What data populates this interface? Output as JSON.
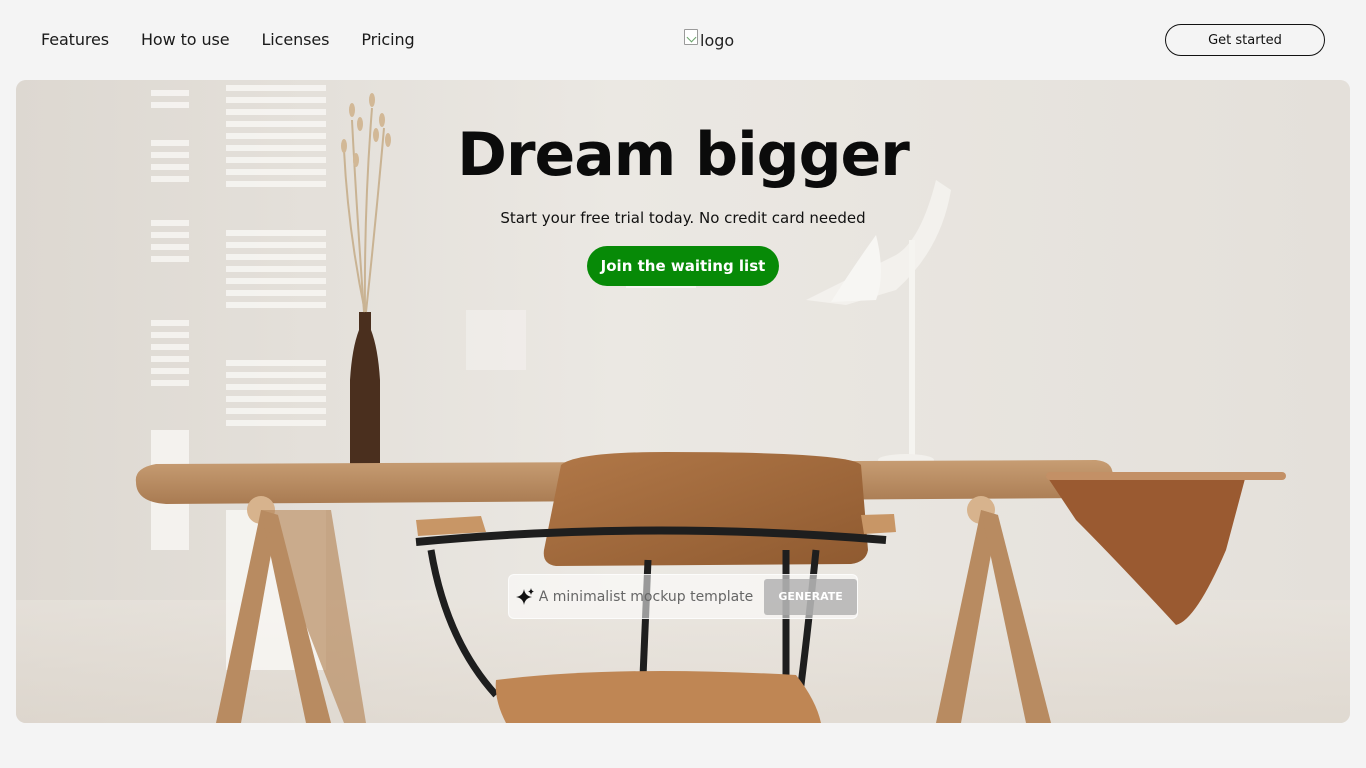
{
  "nav": {
    "links": [
      "Features",
      "How to use",
      "Licenses",
      "Pricing"
    ],
    "logo_alt": "logo",
    "cta_label": "Get started"
  },
  "hero": {
    "title": "Dream bigger",
    "subtitle": "Start your free trial today. No credit card needed",
    "join_label": "Join the waiting list",
    "prompt": {
      "placeholder": "A minimalist mockup template",
      "value": "",
      "generate_label": "GENERATE",
      "icon": "sparkle-icon"
    }
  },
  "colors": {
    "page_bg": "#f4f4f4",
    "accent_green": "#078a07",
    "text": "#111111"
  }
}
